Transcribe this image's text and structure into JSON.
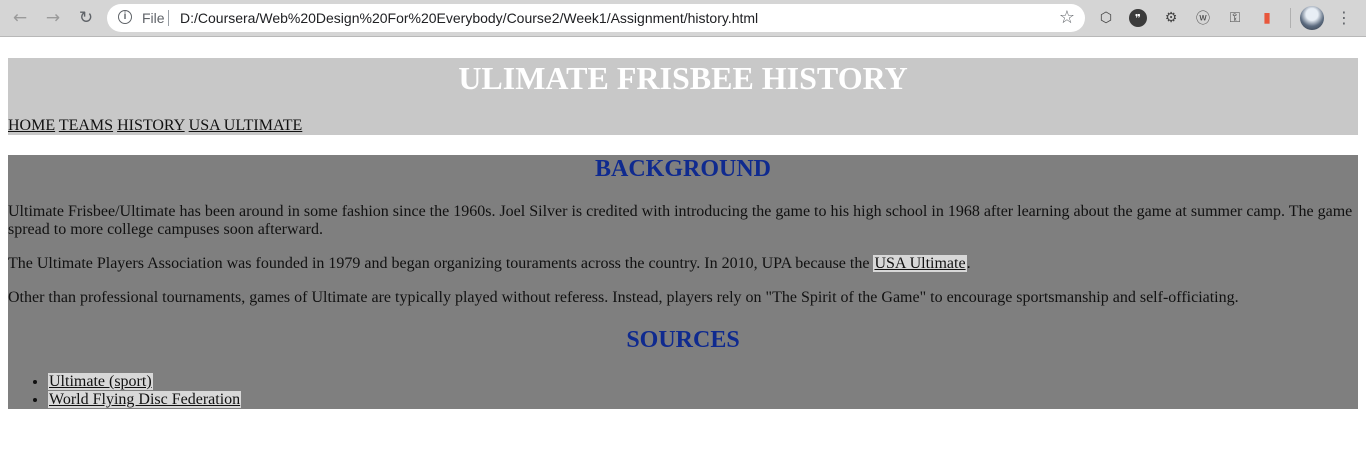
{
  "browser": {
    "scheme_label": "File",
    "url": "D:/Coursera/Web%20Design%20For%20Everybody/Course2/Week1/Assignment/history.html",
    "icons": {
      "back": "back-arrow-icon",
      "forward": "forward-arrow-icon",
      "reload": "reload-icon",
      "info": "info-icon",
      "bookmark": "star-icon",
      "menu": "more-vert-icon"
    },
    "extensions": [
      "shield-icon",
      "chat-quote-icon",
      "gear-icon",
      "w-extension-icon",
      "key-icon",
      "orange-extension-icon"
    ]
  },
  "header": {
    "title": "ULIMATE FRISBEE HISTORY",
    "nav": [
      "HOME",
      "TEAMS",
      "HISTORY",
      "USA ULTIMATE"
    ]
  },
  "background": {
    "heading": "BACKGROUND",
    "p1": "Ultimate Frisbee/Ultimate has been around in some fashion since the 1960s. Joel Silver is credited with introducing the game to his high school in 1968 after learning about the game at summer camp. The game spread to more college campuses soon afterward.",
    "p2_before": "The Ultimate Players Association was founded in 1979 and began organizing touraments across the country. In 2010, UPA because the ",
    "p2_link": "USA Ultimate",
    "p2_after": ".",
    "p3": "Other than professional tournaments, games of Ultimate are typically played without referess. Instead, players rely on \"The Spirit of the Game\" to encourage sportsmanship and self-officiating."
  },
  "sources": {
    "heading": "SOURCES",
    "items": [
      "Ultimate (sport)",
      "World Flying Disc Federation"
    ]
  },
  "colors": {
    "header_bg": "#c8c8c8",
    "content_bg": "#7f7f7f",
    "heading_blue": "#0f2a8f",
    "link_highlight": "#d8d8d8"
  }
}
